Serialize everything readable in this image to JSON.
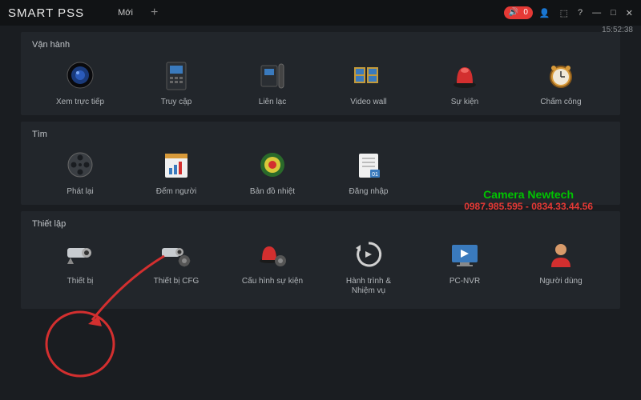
{
  "brand": "SMART PSS",
  "tab_new": "Mới",
  "time": "15:52:38",
  "sections": {
    "operate": {
      "title": "Vận hành",
      "items": [
        "Xem trực tiếp",
        "Truy cập",
        "Liên lạc",
        "Video wall",
        "Sự kiện",
        "Chấm công"
      ]
    },
    "search": {
      "title": "Tìm",
      "items": [
        "Phát lại",
        "Đếm người",
        "Bản đồ nhiệt",
        "Đăng nhập"
      ]
    },
    "config": {
      "title": "Thiết lập",
      "items": [
        "Thiết bị",
        "Thiết bị CFG",
        "Cấu hình sự kiện",
        "Hành trình &\nNhiệm vụ",
        "PC-NVR",
        "Người dùng"
      ]
    }
  },
  "overlay": {
    "line1": "Camera Newtech",
    "line2": "0987.985.595 - 0834.33.44.56"
  }
}
